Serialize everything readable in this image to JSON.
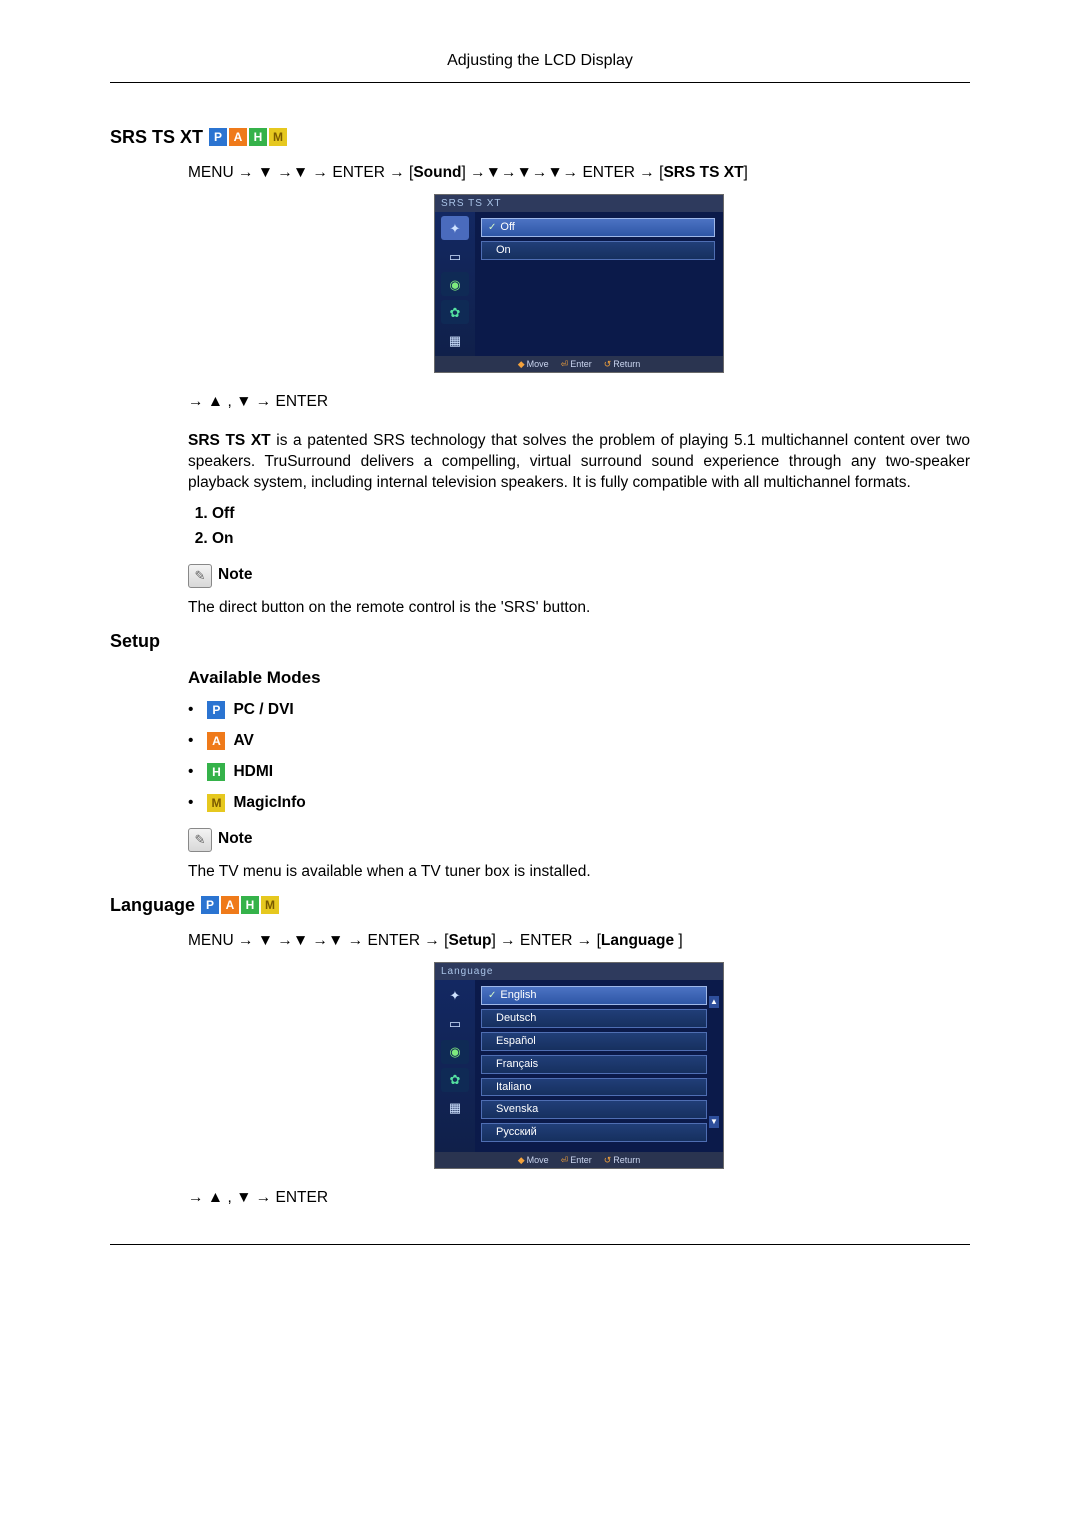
{
  "header": {
    "caption": "Adjusting the LCD Display"
  },
  "badges": {
    "P": "P",
    "A": "A",
    "H": "H",
    "M": "M"
  },
  "srs": {
    "heading": "SRS TS XT",
    "path_prefix": "MENU → ▼ →▼ → ENTER → [",
    "path_sound": "Sound",
    "path_mid": "] →▼→▼→▼→ ENTER → [",
    "path_srs": "SRS TS XT",
    "path_suffix": "]",
    "arrow_line": "→ ▲ , ▼ → ENTER",
    "paragraph": "SRS TS XT is a patented SRS technology that solves the problem of playing 5.1 multichannel content over two speakers. TruSurround delivers a compelling, virtual surround sound experience through any two-speaker playback system, including internal television speakers. It is fully compatible with all multichannel formats.",
    "options": [
      "Off",
      "On"
    ],
    "note_label": "Note",
    "note_text": "The direct button on the remote control is the 'SRS' button.",
    "osd": {
      "title": "SRS TS XT",
      "items": [
        "Off",
        "On"
      ],
      "footer": {
        "move": "Move",
        "enter": "Enter",
        "return": "Return"
      }
    }
  },
  "setup": {
    "heading": "Setup",
    "sub_heading": "Available Modes",
    "modes": [
      {
        "badge": "P",
        "label": "PC / DVI"
      },
      {
        "badge": "A",
        "label": "AV"
      },
      {
        "badge": "H",
        "label": "HDMI"
      },
      {
        "badge": "M",
        "label": "MagicInfo"
      }
    ],
    "note_label": "Note",
    "note_text": "The TV menu is available when a TV tuner box is installed."
  },
  "language": {
    "heading": "Language",
    "path_prefix": "MENU → ▼ →▼ →▼ → ENTER → [",
    "path_setup": "Setup",
    "path_mid": "] → ENTER → [",
    "path_lang": "Language ",
    "path_suffix": "]",
    "arrow_line": "→ ▲ , ▼ → ENTER",
    "osd": {
      "title": "Language",
      "items": [
        "English",
        "Deutsch",
        "Español",
        "Français",
        "Italiano",
        "Svenska",
        "Русский"
      ],
      "footer": {
        "move": "Move",
        "enter": "Enter",
        "return": "Return"
      }
    }
  }
}
